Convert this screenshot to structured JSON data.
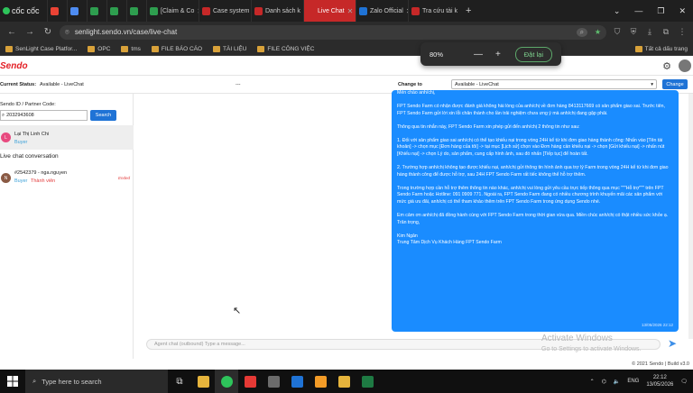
{
  "browser": {
    "logo": "cốc cốc",
    "tabs": [
      {
        "label": "",
        "color": "#ea4335"
      },
      {
        "label": "",
        "color": "#4e8cf2"
      },
      {
        "label": "",
        "color": "#2e9e4f"
      },
      {
        "label": "",
        "color": "#2e9e4f"
      },
      {
        "label": "",
        "color": "#2e9e4f"
      },
      {
        "label": "[Claim & Co",
        "color": "#2e9e4f"
      },
      {
        "label": "Case system",
        "color": "#c62828"
      },
      {
        "label": "Danh sách k",
        "color": "#c62828"
      },
      {
        "label": "Live Chat",
        "color": "#c62828",
        "active": true
      },
      {
        "label": "Zalo Official",
        "color": "#1f73d6"
      },
      {
        "label": "Tra cứu tài k",
        "color": "#c62828"
      }
    ],
    "new_tab": "+",
    "url": "senlight.sendo.vn/case/live-chat",
    "bookmarks": [
      "SenLight Case Platfor...",
      "OPC",
      "tms",
      "FILE BÁO CÁO",
      "TÀI LIỆU",
      "FILE CÔNG VIỆC"
    ],
    "bookmarks_right": "Tất cả dấu trang",
    "zoom": {
      "level": "80%",
      "minus": "—",
      "plus": "+",
      "reset": "Đặt lại"
    }
  },
  "app": {
    "logo": "Sendo",
    "status_label": "Current Status:",
    "status_value": "Available - LiveChat",
    "center_placeholder": "---",
    "change_to_label": "Change to",
    "change_to_value": "Available - LiveChat",
    "change_button": "Change",
    "search_label": "Sendo ID / Partner Code:",
    "search_value": "2032943608",
    "search_button": "Search",
    "search_result": {
      "avatar": "L",
      "name": "Lại Thị Linh Chi",
      "role": "Buyer"
    },
    "live_section": "Live chat conversation",
    "conversation": {
      "avatar": "N",
      "title": "#2542379 - nga.nguyen",
      "role": "Buyer",
      "tier": "Thành viên",
      "status": "Ended"
    },
    "message_paragraphs": [
      "Mến chào anh/chị,",
      "FPT Sendo Farm có nhận được đánh giá không hài lòng của anh/chị về đơn hàng 8413117669 có sản phẩm giao sai. Trước tiên, FPT Sendo Farm gửi lời xin lỗi chân thành cho lần trải nghiệm chưa ưng ý mà anh/chị đang gặp phải.",
      "Thông qua tin nhắn này, FPT Sendo Farm xin phép gửi đến anh/chị 2 thông tin như sau:",
      "1. Đối với sản phẩm giao sai anh/chị có thể tạo khiếu nại trong vòng 24H kể từ khi đơn giao hàng thành công: Nhấn vào [Tên tài khoản] -> chọn mục [Đơn hàng của tôi] -> tại mục [Lịch sử] chọn vào Đơn hàng cần khiếu nại -> chọn [Gửi khiếu nại] -> nhấn nút [Khiếu nại] -> chọn Lý do, sản phẩm, cung cấp hình ảnh, sau đó nhấn [Tiếp tục] để hoàn tất.",
      "2. Trường hợp anh/chị không tạo được khiếu nại, anh/chị gửi thông tin hình ảnh qua trợ lý Farm trong vòng 24H kể từ khi đơn giao hàng thành công để được hỗ trợ, sau 24H FPT Sendo Farm rất tiếc không thể hỗ trợ thêm.",
      "Trong trường hợp cần hỗ trợ thêm thông tin nào khác, anh/chị vui lòng gửi yêu cầu trực tiếp thông qua mục \"\"\"Hỗ trợ\"\"\" trên FPT Sendo Farm hoặc Hotline: 091 0909 771. Ngoài ra, FPT Sendo Farm đang có nhiều chương trình khuyến mãi các sản phẩm với mức giá ưu đãi, anh/chị có thể tham khảo thêm trên FPT Sendo Farm trong ứng dụng Sendo nhé.",
      "Em cảm ơn anh/chị đã đồng hành cùng với FPT Sendo Farm trong thời gian vừa qua. Miền chúc anh/chị có thật nhiều sức khỏe ạ.\nTrân trọng,",
      "Kim Ngân\nTrung Tâm Dịch Vụ Khách Hàng FPT Sendo Farm"
    ],
    "message_time": "13/05/2026 22:12",
    "input_placeholder": "Agent chat (outbound) Type a message...",
    "footer": "© 2021 Sendo | Build v3.0",
    "watermark_title": "Activate Windows",
    "watermark_sub": "Go to Settings to activate Windows."
  },
  "taskbar": {
    "search_placeholder": "Type here to search",
    "time": "22:12",
    "date": "13/05/2026",
    "tray_label": "ENG"
  }
}
